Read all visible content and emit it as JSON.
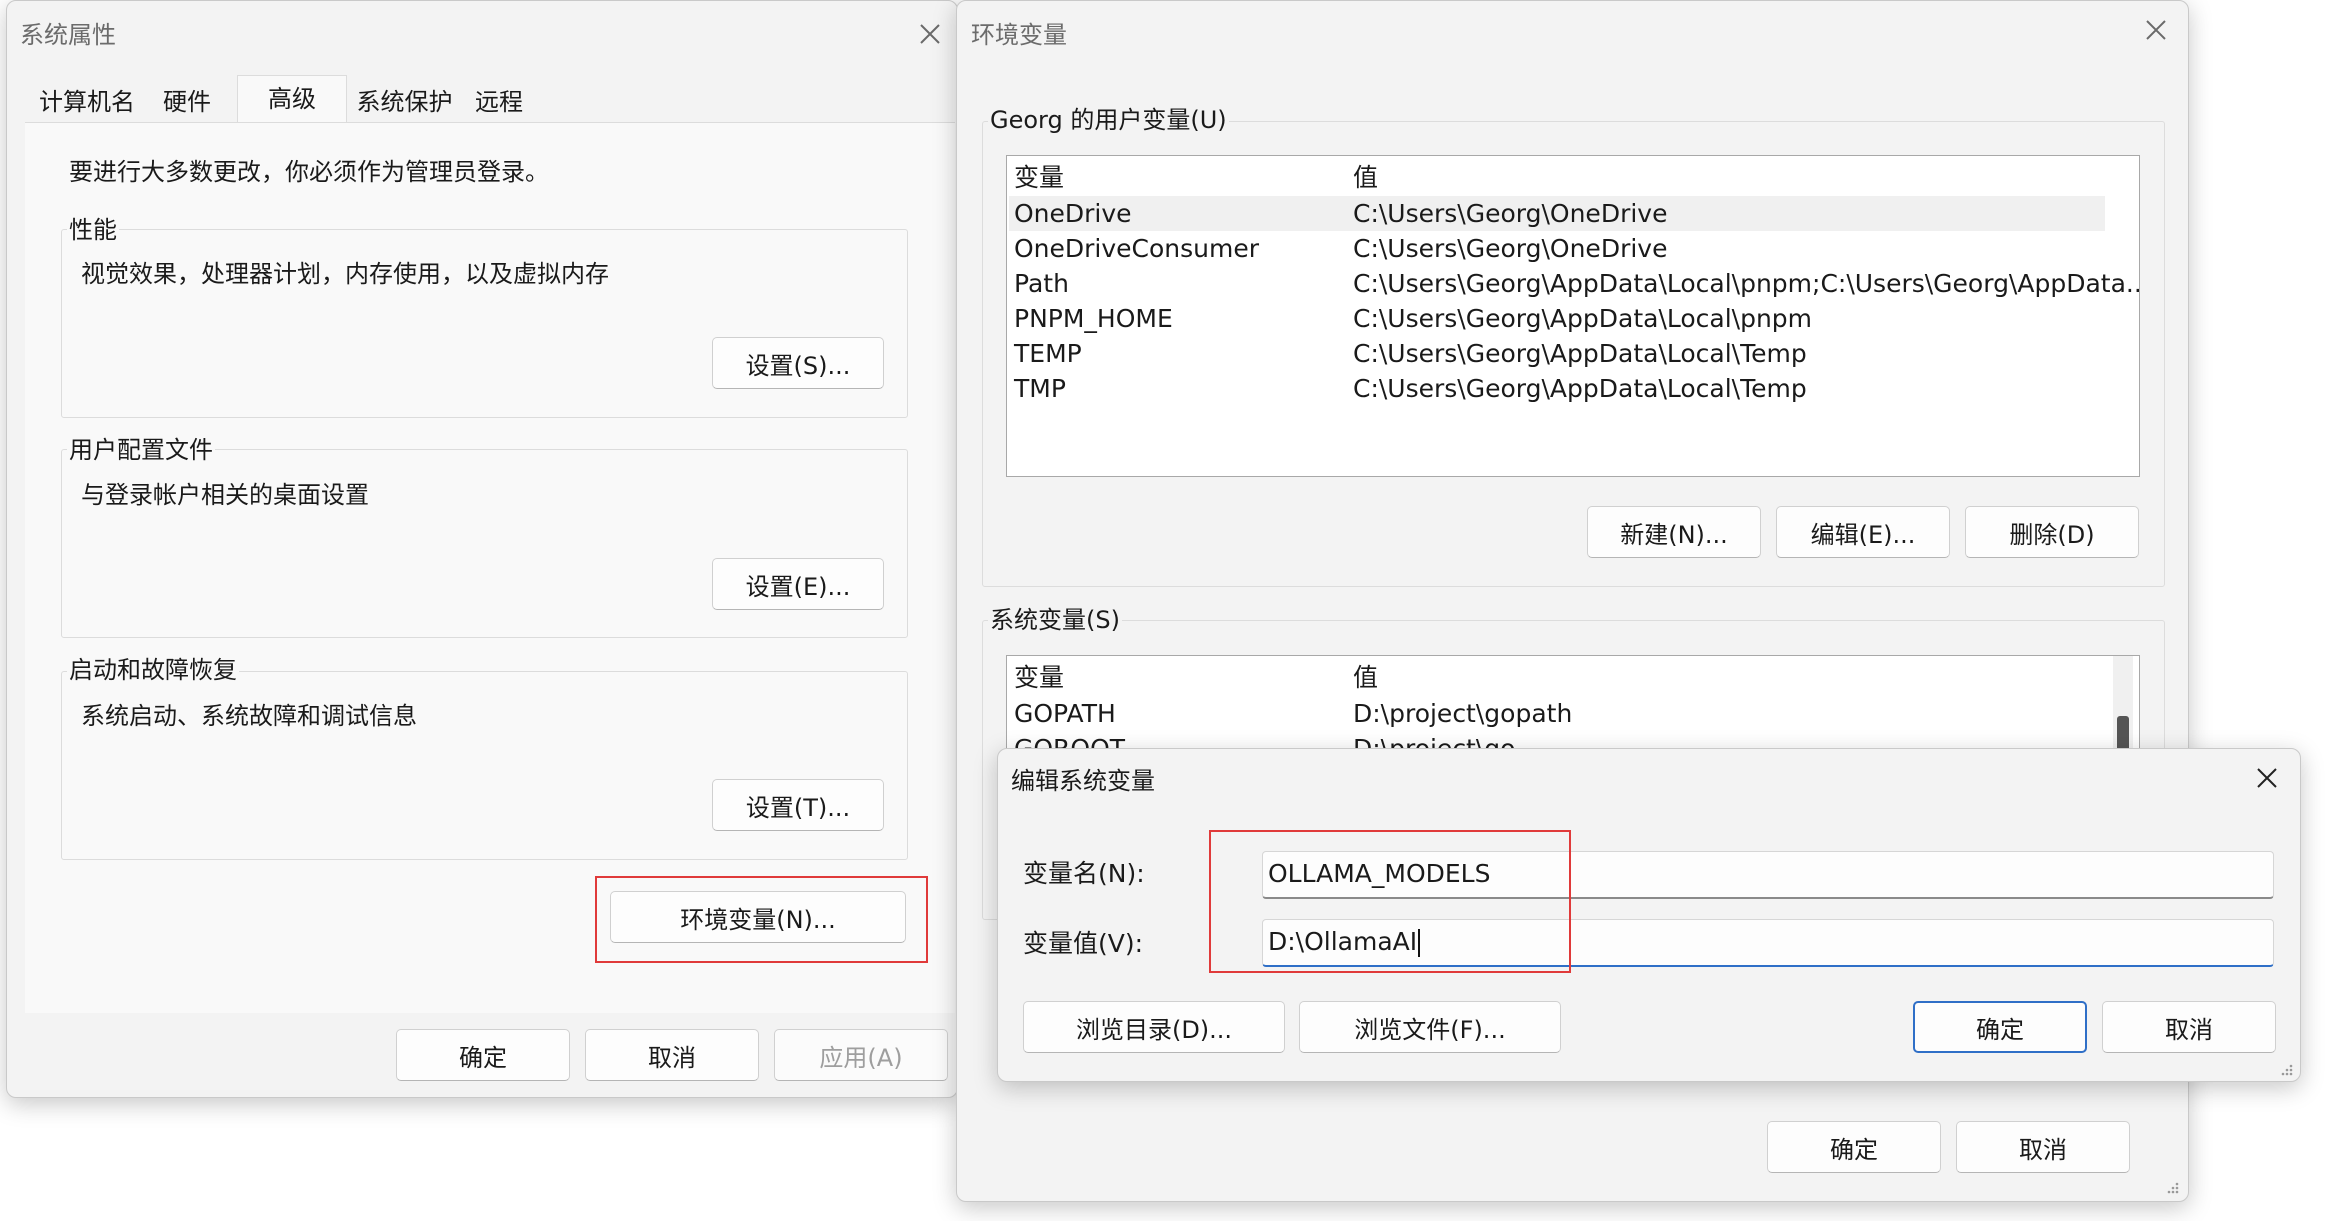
{
  "system_properties": {
    "title": "系统属性",
    "tabs": [
      "计算机名",
      "硬件",
      "高级",
      "系统保护",
      "远程"
    ],
    "admin_notice": "要进行大多数更改，你必须作为管理员登录。",
    "performance": {
      "label": "性能",
      "description": "视觉效果，处理器计划，内存使用，以及虚拟内存",
      "button": "设置(S)..."
    },
    "user_profiles": {
      "label": "用户配置文件",
      "description": "与登录帐户相关的桌面设置",
      "button": "设置(E)..."
    },
    "startup_recovery": {
      "label": "启动和故障恢复",
      "description": "系统启动、系统故障和调试信息",
      "button": "设置(T)..."
    },
    "env_button": "环境变量(N)...",
    "ok": "确定",
    "cancel": "取消",
    "apply": "应用(A)"
  },
  "environment_variables": {
    "title": "环境变量",
    "user_section": "Georg 的用户变量(U)",
    "columns": {
      "name": "变量",
      "value": "值"
    },
    "user_vars": [
      {
        "name": "OneDrive",
        "value": "C:\\Users\\Georg\\OneDrive"
      },
      {
        "name": "OneDriveConsumer",
        "value": "C:\\Users\\Georg\\OneDrive"
      },
      {
        "name": "Path",
        "value": "C:\\Users\\Georg\\AppData\\Local\\pnpm;C:\\Users\\Georg\\AppData..."
      },
      {
        "name": "PNPM_HOME",
        "value": "C:\\Users\\Georg\\AppData\\Local\\pnpm"
      },
      {
        "name": "TEMP",
        "value": "C:\\Users\\Georg\\AppData\\Local\\Temp"
      },
      {
        "name": "TMP",
        "value": "C:\\Users\\Georg\\AppData\\Local\\Temp"
      }
    ],
    "user_buttons": {
      "new": "新建(N)...",
      "edit": "编辑(E)...",
      "delete": "删除(D)"
    },
    "system_section": "系统变量(S)",
    "system_vars": [
      {
        "name": "GOPATH",
        "value": "D:\\project\\gopath"
      },
      {
        "name": "GOROOT",
        "value": "D:\\project\\go"
      }
    ],
    "ok": "确定",
    "cancel": "取消"
  },
  "edit_dialog": {
    "title": "编辑系统变量",
    "name_label": "变量名(N):",
    "name_value": "OLLAMA_MODELS",
    "value_label": "变量值(V):",
    "value_value": "D:\\OllamaAI",
    "browse_dir": "浏览目录(D)...",
    "browse_file": "浏览文件(F)...",
    "ok": "确定",
    "cancel": "取消"
  },
  "colors": {
    "highlight": "#e03a3a",
    "accent": "#2f6fc7"
  }
}
